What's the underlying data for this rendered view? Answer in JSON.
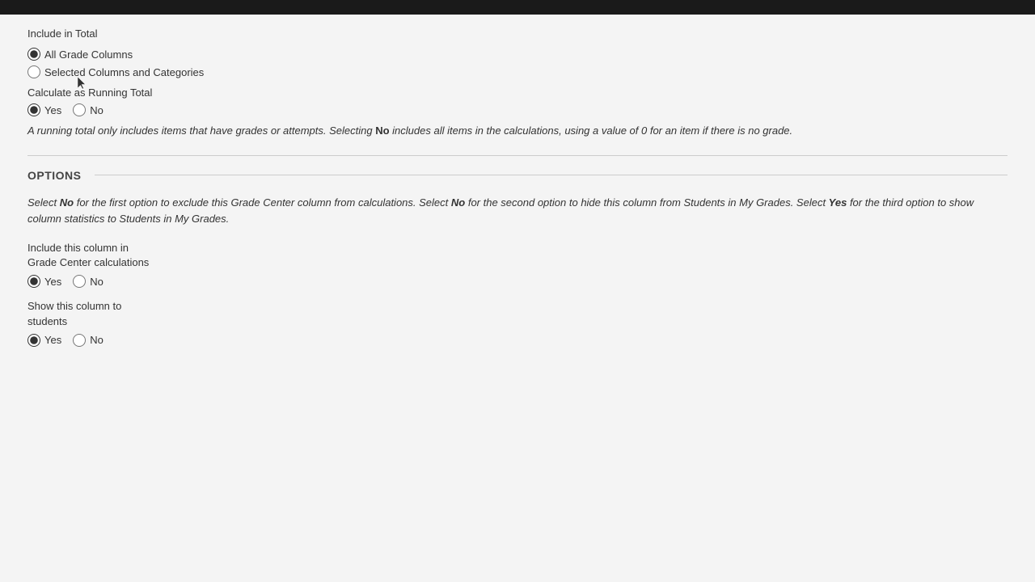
{
  "topBar": {},
  "includeInTotal": {
    "label": "Include in Total",
    "options": [
      {
        "id": "all-grade-columns",
        "label": "All Grade Columns",
        "checked": true
      },
      {
        "id": "selected-columns",
        "label": "Selected Columns and Categories",
        "checked": false
      }
    ]
  },
  "calculateRunningTotal": {
    "label": "Calculate as Running Total",
    "options": [
      {
        "id": "running-yes",
        "label": "Yes",
        "checked": true
      },
      {
        "id": "running-no",
        "label": "No",
        "checked": false
      }
    ],
    "description_before": "A running total only includes items that have grades or attempts. Selecting ",
    "description_bold": "No",
    "description_after": " includes all items in the calculations, using a value of 0 for an item if there is no grade."
  },
  "options": {
    "sectionTitle": "OPTIONS",
    "description_part1": "Select ",
    "description_bold1": "No",
    "description_part2": " for the first option to exclude this Grade Center column from calculations. Select ",
    "description_bold2": "No",
    "description_part3": " for the second option to hide this column from Students in My Grades. Select ",
    "description_bold3": "Yes",
    "description_part4": " for the third option to show column statistics to Students in My Grades.",
    "includeColumn": {
      "label1": "Include this column in",
      "label2": "Grade Center calculations",
      "options": [
        {
          "id": "include-yes",
          "label": "Yes",
          "checked": true
        },
        {
          "id": "include-no",
          "label": "No",
          "checked": false
        }
      ]
    },
    "showColumn": {
      "label1": "Show this column to",
      "label2": "students",
      "options": [
        {
          "id": "show-yes",
          "label": "Yes",
          "checked": true
        },
        {
          "id": "show-no",
          "label": "No",
          "checked": false
        }
      ]
    }
  }
}
